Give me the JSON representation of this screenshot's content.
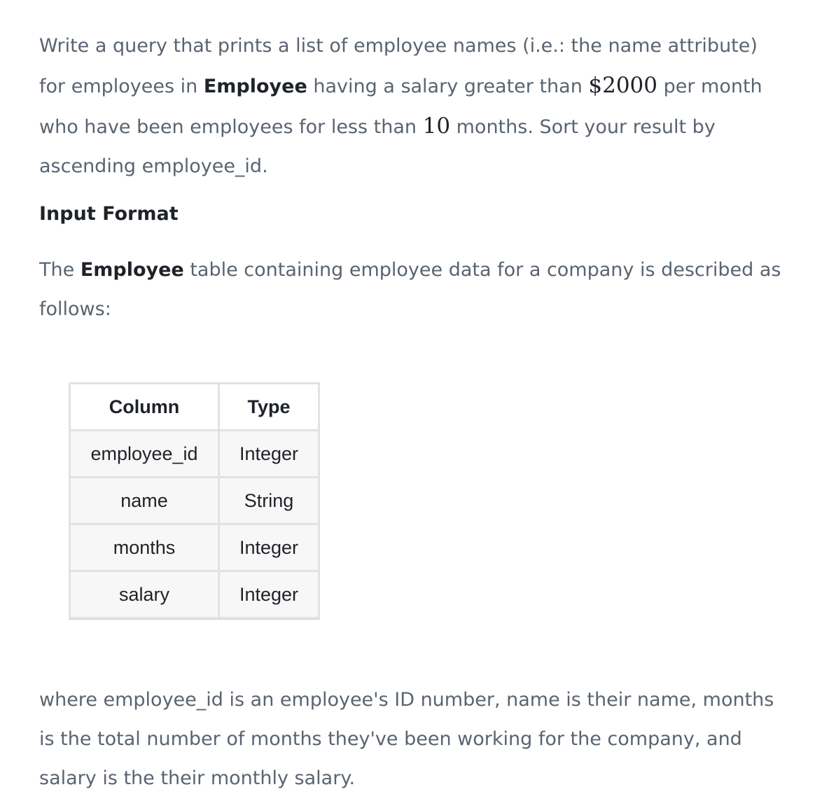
{
  "intro": {
    "t1": "Write a query that prints a list of employee names (i.e.: the name attribute) for employees in ",
    "table_name": "Employee",
    "t2": " having a salary greater than ",
    "salary_value": "$2000",
    "t3": " per month who have been employees for less than ",
    "months_value": "10",
    "t4": " months. Sort your result by ascending employee_id."
  },
  "input_format": {
    "heading": "Input Format",
    "t1": "The ",
    "table_name": "Employee",
    "t2": " table containing employee data for a company is described as follows:"
  },
  "schema_table": {
    "headers": [
      "Column",
      "Type"
    ],
    "rows": [
      [
        "employee_id",
        "Integer"
      ],
      [
        "name",
        "String"
      ],
      [
        "months",
        "Integer"
      ],
      [
        "salary",
        "Integer"
      ]
    ]
  },
  "footer": {
    "text": "where employee_id is an employee's ID number, name is their name, months is the total number of months they've been working for the company, and salary is the their monthly salary."
  }
}
